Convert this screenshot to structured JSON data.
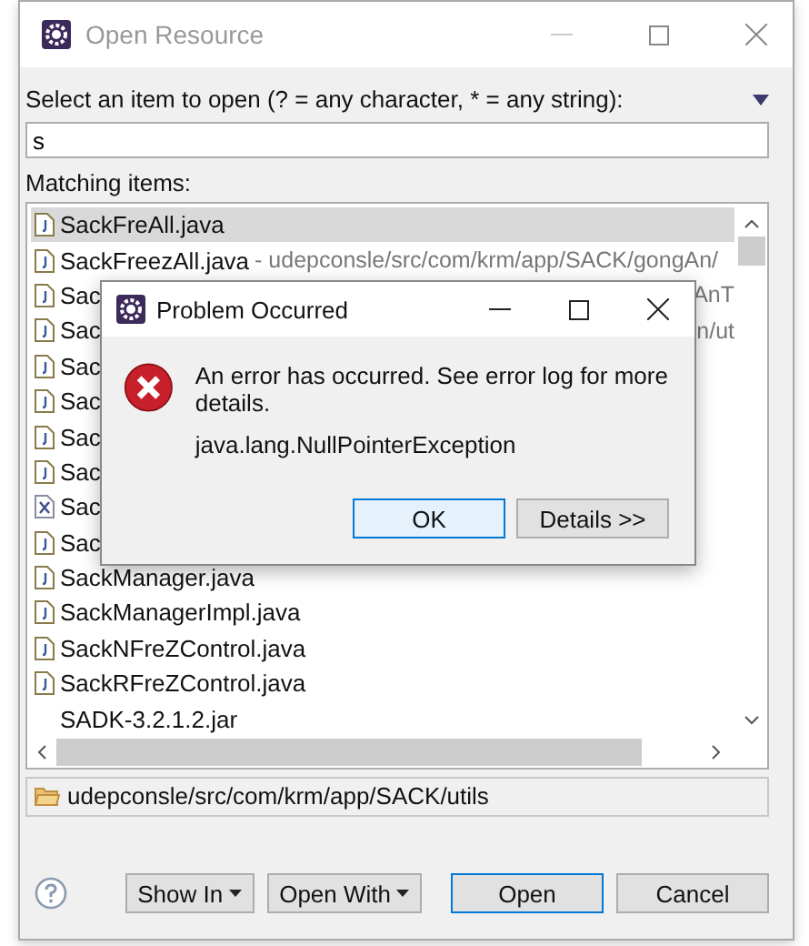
{
  "window": {
    "title": "Open Resource"
  },
  "filter": {
    "label": "Select an item to open (? = any character, * = any string):",
    "value": "s"
  },
  "matching_label": "Matching items:",
  "items": [
    {
      "name": "SackFreAll.java",
      "kind": "java",
      "selected": true
    },
    {
      "name": "SackFreezAll.java",
      "detail": "- udepconsle/src/com/krm/app/SACK/gongAn/",
      "kind": "java",
      "selected": false
    },
    {
      "name": "Sac",
      "tail": "AnT",
      "kind": "java",
      "selected": false
    },
    {
      "name": "Sac",
      "tail": "n/ut",
      "kind": "java",
      "selected": false
    },
    {
      "name": "Sac",
      "kind": "java",
      "selected": false
    },
    {
      "name": "Sac",
      "kind": "java",
      "selected": false
    },
    {
      "name": "Sac",
      "kind": "java",
      "selected": false
    },
    {
      "name": "Sac",
      "kind": "java",
      "selected": false
    },
    {
      "name": "Sac",
      "kind": "xml",
      "selected": false
    },
    {
      "name": "Sac",
      "kind": "java",
      "selected": false
    },
    {
      "name": "SackManager.java",
      "kind": "java",
      "selected": false
    },
    {
      "name": "SackManagerImpl.java",
      "kind": "java",
      "selected": false
    },
    {
      "name": "SackNFreZControl.java",
      "kind": "java",
      "selected": false
    },
    {
      "name": "SackRFreZControl.java",
      "kind": "java",
      "selected": false
    },
    {
      "name": "SADK-3.2.1.2.jar",
      "kind": "jar",
      "selected": false
    }
  ],
  "path": "udepconsle/src/com/krm/app/SACK/utils",
  "buttons": [
    {
      "label": "Show In",
      "kind": "menu",
      "default": false
    },
    {
      "label": "Open With",
      "kind": "menu",
      "default": false
    },
    {
      "label": "Open",
      "kind": "plain",
      "default": true
    },
    {
      "label": "Cancel",
      "kind": "plain",
      "default": false
    }
  ],
  "error_dialog": {
    "title": "Problem Occurred",
    "message": "An error has occurred. See error log for more details.",
    "exception": "java.lang.NullPointerException",
    "buttons": [
      {
        "label": "OK",
        "default": true
      },
      {
        "label": "Details >>",
        "default": false
      }
    ]
  }
}
